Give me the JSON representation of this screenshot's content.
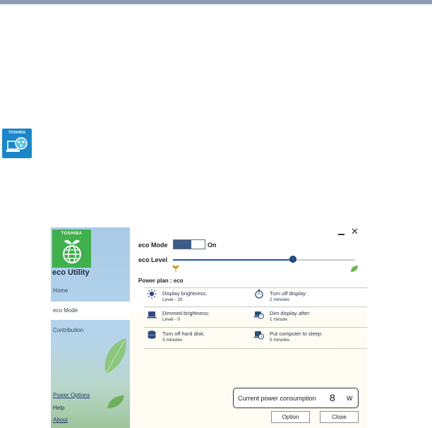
{
  "desktop": {
    "shortcut_brand": "TOSHIBA"
  },
  "app": {
    "brand": "TOSHIBA",
    "title": "eco Utility",
    "controls": {
      "minimize": "minimize-icon",
      "close": "close-icon"
    }
  },
  "sidebar": {
    "items": [
      {
        "label": "Home"
      },
      {
        "label": "eco Mode",
        "active": true
      },
      {
        "label": "Contribution"
      }
    ],
    "links": [
      {
        "label": "Power Options",
        "underlined": true
      },
      {
        "label": "Help",
        "underlined": false
      },
      {
        "label": "About",
        "underlined": true
      }
    ]
  },
  "eco_mode": {
    "label": "eco Mode",
    "state": "On",
    "enabled": true
  },
  "eco_level": {
    "label": "eco Level",
    "level_fraction": 0.66
  },
  "power_plan": {
    "label": "Power plan",
    "value": "eco",
    "text": "Power plan  :  eco"
  },
  "settings": [
    {
      "title": "Display brightness:",
      "value": "Level - 20",
      "icon": "brightness-icon"
    },
    {
      "title": "Turn off display:",
      "value": "2 minutes",
      "icon": "timer-icon"
    },
    {
      "title": "Dimmed brightness:",
      "value": "Level - 0",
      "icon": "laptop-icon"
    },
    {
      "title": "Dim display after:",
      "value": "1 minute",
      "icon": "laptop-clock-icon"
    },
    {
      "title": "Turn off hard disk:",
      "value": "3 minutes",
      "icon": "hard-disk-icon"
    },
    {
      "title": "Put computer to sleep:",
      "value": "5 minutes",
      "icon": "sleep-computer-icon"
    }
  ],
  "power_consumption": {
    "label": "Current power consumption",
    "value": "8",
    "unit": "W"
  },
  "buttons": {
    "option": "Option",
    "close": "Close"
  },
  "colors": {
    "accent": "#1e5aa6",
    "toggle_on": "#3e5a86",
    "eco_green": "#3fb04b",
    "topbar": "#8b9bb0"
  }
}
